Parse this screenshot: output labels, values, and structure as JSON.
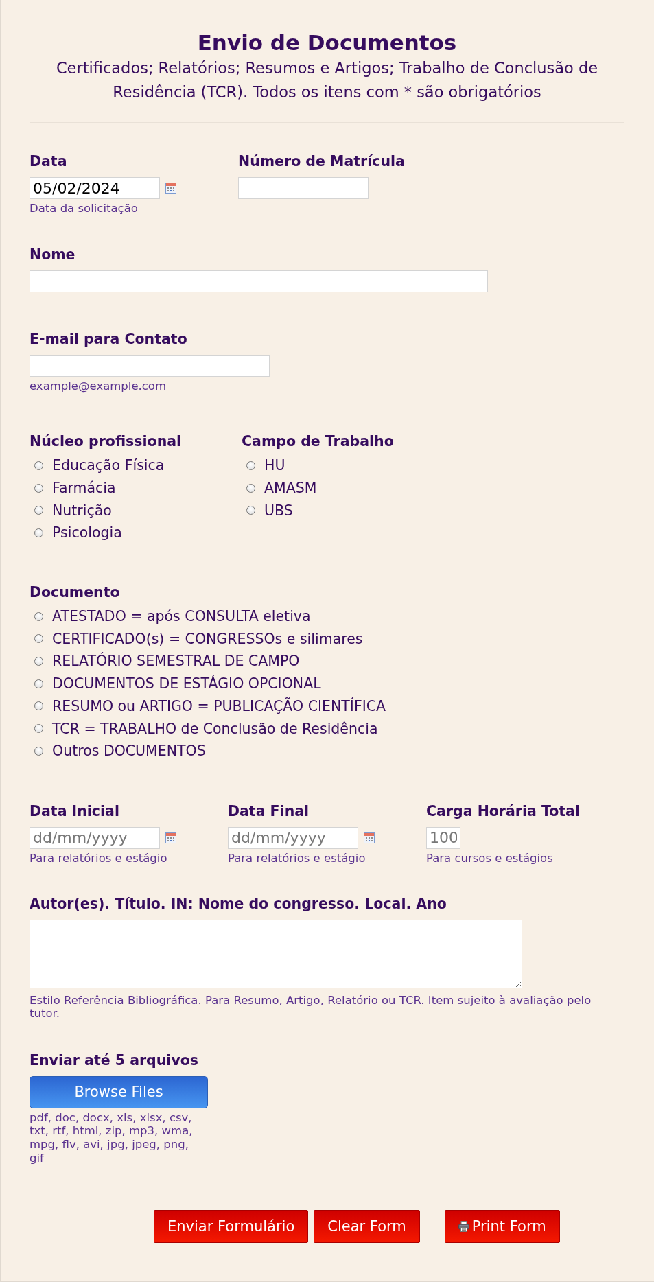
{
  "header": {
    "title": "Envio de Documentos",
    "subtitle": "Certificados; Relatórios; Resumos e Artigos; Trabalho de Conclusão de Residência (TCR). Todos os itens com * são obrigatórios"
  },
  "data": {
    "label": "Data",
    "value": "05/02/2024",
    "sublabel": "Data da solicitação"
  },
  "matricula": {
    "label": "Número de Matrícula"
  },
  "nome": {
    "label": "Nome"
  },
  "email": {
    "label": "E-mail para Contato",
    "sublabel": "example@example.com"
  },
  "nucleo": {
    "label": "Núcleo profissional",
    "options": [
      {
        "label": "Educação Física",
        "selected": false
      },
      {
        "label": "Farmácia",
        "selected": false
      },
      {
        "label": "Nutrição",
        "selected": false
      },
      {
        "label": "Psicologia",
        "selected": false
      }
    ]
  },
  "campo": {
    "label": "Campo de Trabalho",
    "options": [
      {
        "label": "HU",
        "selected": false
      },
      {
        "label": "AMASM",
        "selected": false
      },
      {
        "label": "UBS",
        "selected": false
      }
    ]
  },
  "documento": {
    "label": "Documento",
    "options": [
      {
        "label": "ATESTADO = após CONSULTA eletiva",
        "selected": false
      },
      {
        "label": "CERTIFICADO(s) = CONGRESSOs e silimares",
        "selected": false
      },
      {
        "label": "RELATÓRIO SEMESTRAL DE CAMPO",
        "selected": false
      },
      {
        "label": "DOCUMENTOS DE ESTÁGIO OPCIONAL",
        "selected": false
      },
      {
        "label": "RESUMO ou ARTIGO = PUBLICAÇÃO CIENTÍFICA",
        "selected": false
      },
      {
        "label": "TCR = TRABALHO de Conclusão de Residência",
        "selected": false
      },
      {
        "label": "Outros DOCUMENTOS",
        "selected": false
      }
    ]
  },
  "data_inicial": {
    "label": "Data Inicial",
    "placeholder": "dd/mm/yyyy",
    "sublabel": "Para relatórios e estágio"
  },
  "data_final": {
    "label": "Data Final",
    "placeholder": "dd/mm/yyyy",
    "sublabel": "Para relatórios e estágio"
  },
  "carga_horaria": {
    "label": "Carga Horária Total",
    "placeholder": "100",
    "sublabel": "Para cursos e estágios"
  },
  "referencia": {
    "label": "Autor(es). Título. IN: Nome do congresso. Local. Ano",
    "sublabel": "Estilo Referência Bibliográfica. Para Resumo, Artigo, Relatório ou TCR. Item sujeito à avaliação pelo tutor."
  },
  "upload": {
    "label": "Enviar até 5 arquivos",
    "button": "Browse Files",
    "file_types": "pdf, doc, docx, xls, xlsx, csv, txt, rtf, html, zip, mp3, wma, mpg, flv, avi, jpg, jpeg, png, gif"
  },
  "buttons": [
    {
      "kind": "submit",
      "label": "Enviar Formulário"
    },
    {
      "kind": "clear",
      "label": "Clear Form"
    },
    {
      "kind": "print",
      "label": "Print Form"
    }
  ]
}
